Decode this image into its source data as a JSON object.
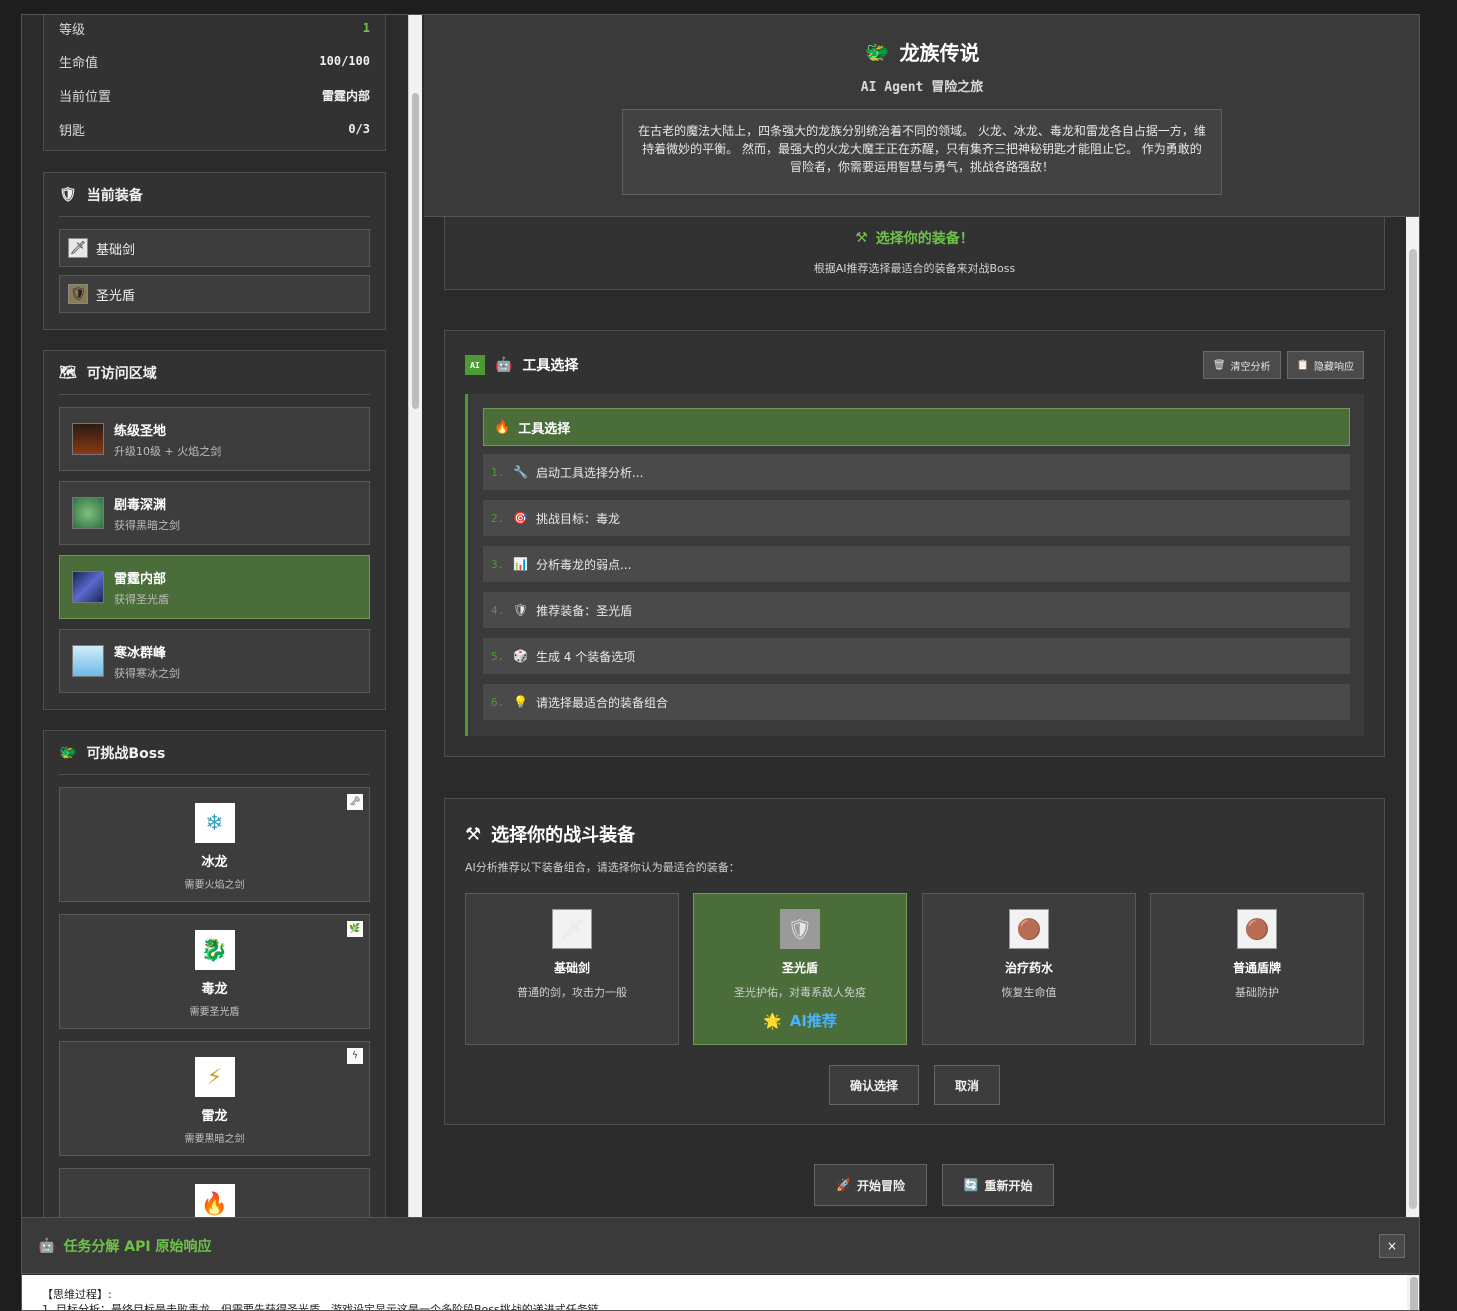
{
  "stats": [
    {
      "label": "等级",
      "value": "1"
    },
    {
      "label": "生命值",
      "value": "100/100"
    },
    {
      "label": "当前位置",
      "value": "雷霆内部"
    },
    {
      "label": "钥匙",
      "value": "0/3"
    }
  ],
  "equipment": {
    "title": "当前装备",
    "items": [
      {
        "name": "基础剑",
        "icon": "🗡"
      },
      {
        "name": "圣光盾",
        "icon": "🛡"
      }
    ]
  },
  "areas": {
    "title": "可访问区域",
    "items": [
      {
        "name": "练级圣地",
        "desc": "升级10级 + 火焰之剑",
        "color": "#6b2a12"
      },
      {
        "name": "剧毒深渊",
        "desc": "获得黑暗之剑",
        "color": "#3d8a52"
      },
      {
        "name": "雷霆内部",
        "desc": "获得圣光盾",
        "color": "#2a3a8a"
      },
      {
        "name": "寒冰群峰",
        "desc": "获得寒冰之剑",
        "color": "#9fd6f0"
      }
    ]
  },
  "bosses": {
    "title": "可挑战Boss",
    "items": [
      {
        "name": "冰龙",
        "req": "需要火焰之剑",
        "icon": "❄"
      },
      {
        "name": "毒龙",
        "req": "需要圣光盾",
        "icon": "🐉"
      },
      {
        "name": "雷龙",
        "req": "需要黑暗之剑",
        "icon": "⚡"
      },
      {
        "name": "",
        "req": "",
        "icon": "🔥"
      }
    ]
  },
  "header": {
    "title": "龙族传说",
    "subtitle": "AI Agent 冒险之旅",
    "story": "在古老的魔法大陆上，四条强大的龙族分别统治着不同的领域。 火龙、冰龙、毒龙和雷龙各自占据一方，维持着微妙的平衡。 然而，最强大的火龙大魔王正在苏醒，只有集齐三把神秘钥匙才能阻止它。 作为勇敢的冒险者，你需要运用智慧与勇气，挑战各路强敌！"
  },
  "hint": {
    "title": "选择你的装备！",
    "sub": "根据AI推荐选择最适合的装备来对战Boss"
  },
  "tools": {
    "title": "工具选择",
    "badge": "AI",
    "clear_label": "清空分析",
    "hide_label": "隐藏响应",
    "main_step": "工具选择",
    "steps": [
      {
        "n": "1.",
        "icon": "🔧",
        "text": "启动工具选择分析..."
      },
      {
        "n": "2.",
        "icon": "🎯",
        "text": "挑战目标：毒龙"
      },
      {
        "n": "3.",
        "icon": "📊",
        "text": "分析毒龙的弱点..."
      },
      {
        "n": "4.",
        "icon": "🛡",
        "text": "推荐装备：圣光盾"
      },
      {
        "n": "5.",
        "icon": "🎲",
        "text": "生成 4 个装备选项"
      },
      {
        "n": "6.",
        "icon": "💡",
        "text": "请选择最适合的装备组合"
      }
    ]
  },
  "battle": {
    "title": "选择你的战斗装备",
    "sub": "AI分析推荐以下装备组合，请选择你认为最适合的装备：",
    "options": [
      {
        "name": "基础剑",
        "desc": "普通的剑，攻击力一般",
        "icon": "🗡"
      },
      {
        "name": "圣光盾",
        "desc": "圣光护佑，对毒系敌人免疫",
        "icon": "🛡",
        "rec": "AI推荐"
      },
      {
        "name": "治疗药水",
        "desc": "恢复生命值",
        "icon": "🟤"
      },
      {
        "name": "普通盾牌",
        "desc": "基础防护",
        "icon": "🟤"
      }
    ],
    "confirm_label": "确认选择",
    "cancel_label": "取消"
  },
  "actions": {
    "start_label": "开始冒险",
    "restart_label": "重新开始"
  },
  "api": {
    "title": "任务分解 API 原始响应",
    "close": "×",
    "line1": "【思维过程】:",
    "line2": "1. 目标分析：最终目标是击败毒龙，但需要先获得圣光盾。游戏设定显示这是一个多阶段Boss挑战的递进式任务链"
  },
  "colors": {
    "accent_green": "#4d9a35",
    "selected_bg": "#4a6d3a",
    "ai_blue": "#4ab3ff"
  }
}
